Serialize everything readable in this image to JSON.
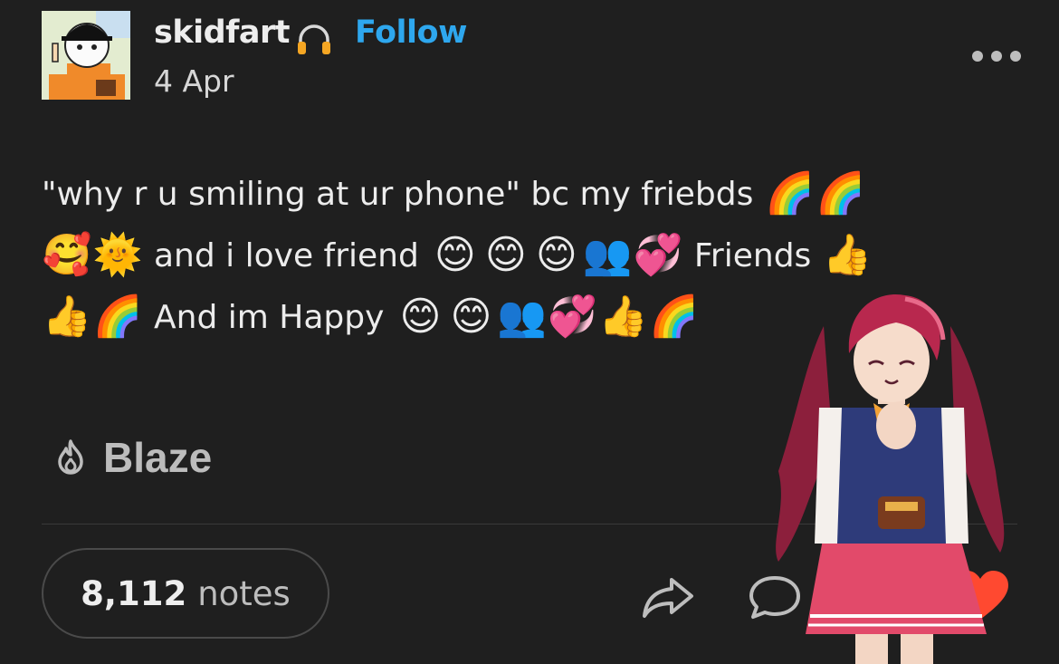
{
  "post": {
    "username": "skidfart",
    "follow_label": "Follow",
    "date": "4 Apr",
    "line1_text": "\"why r u smiling at ur phone\" bc my friebds",
    "line2_text_a": "and i love friend",
    "line2_text_b": "Friends",
    "line3_text": "And im Happy",
    "emoji": {
      "rainbow": "🌈",
      "smiling_hearts": "🥰",
      "sun_face": "🌞",
      "blush": "😊",
      "busts": "👥",
      "revolving_hearts": "💞",
      "thumbs_up": "👍"
    }
  },
  "footer": {
    "blaze_label": "Blaze",
    "notes_count": "8,112",
    "notes_label": "notes"
  },
  "icons": [
    "headphones-icon",
    "more-options-icon",
    "flame-icon",
    "share-icon",
    "reply-icon",
    "heart-icon"
  ],
  "colors": {
    "background": "#1f1f1f",
    "follow": "#2ea7ee",
    "heart": "#ff4930",
    "text": "#ececec"
  }
}
